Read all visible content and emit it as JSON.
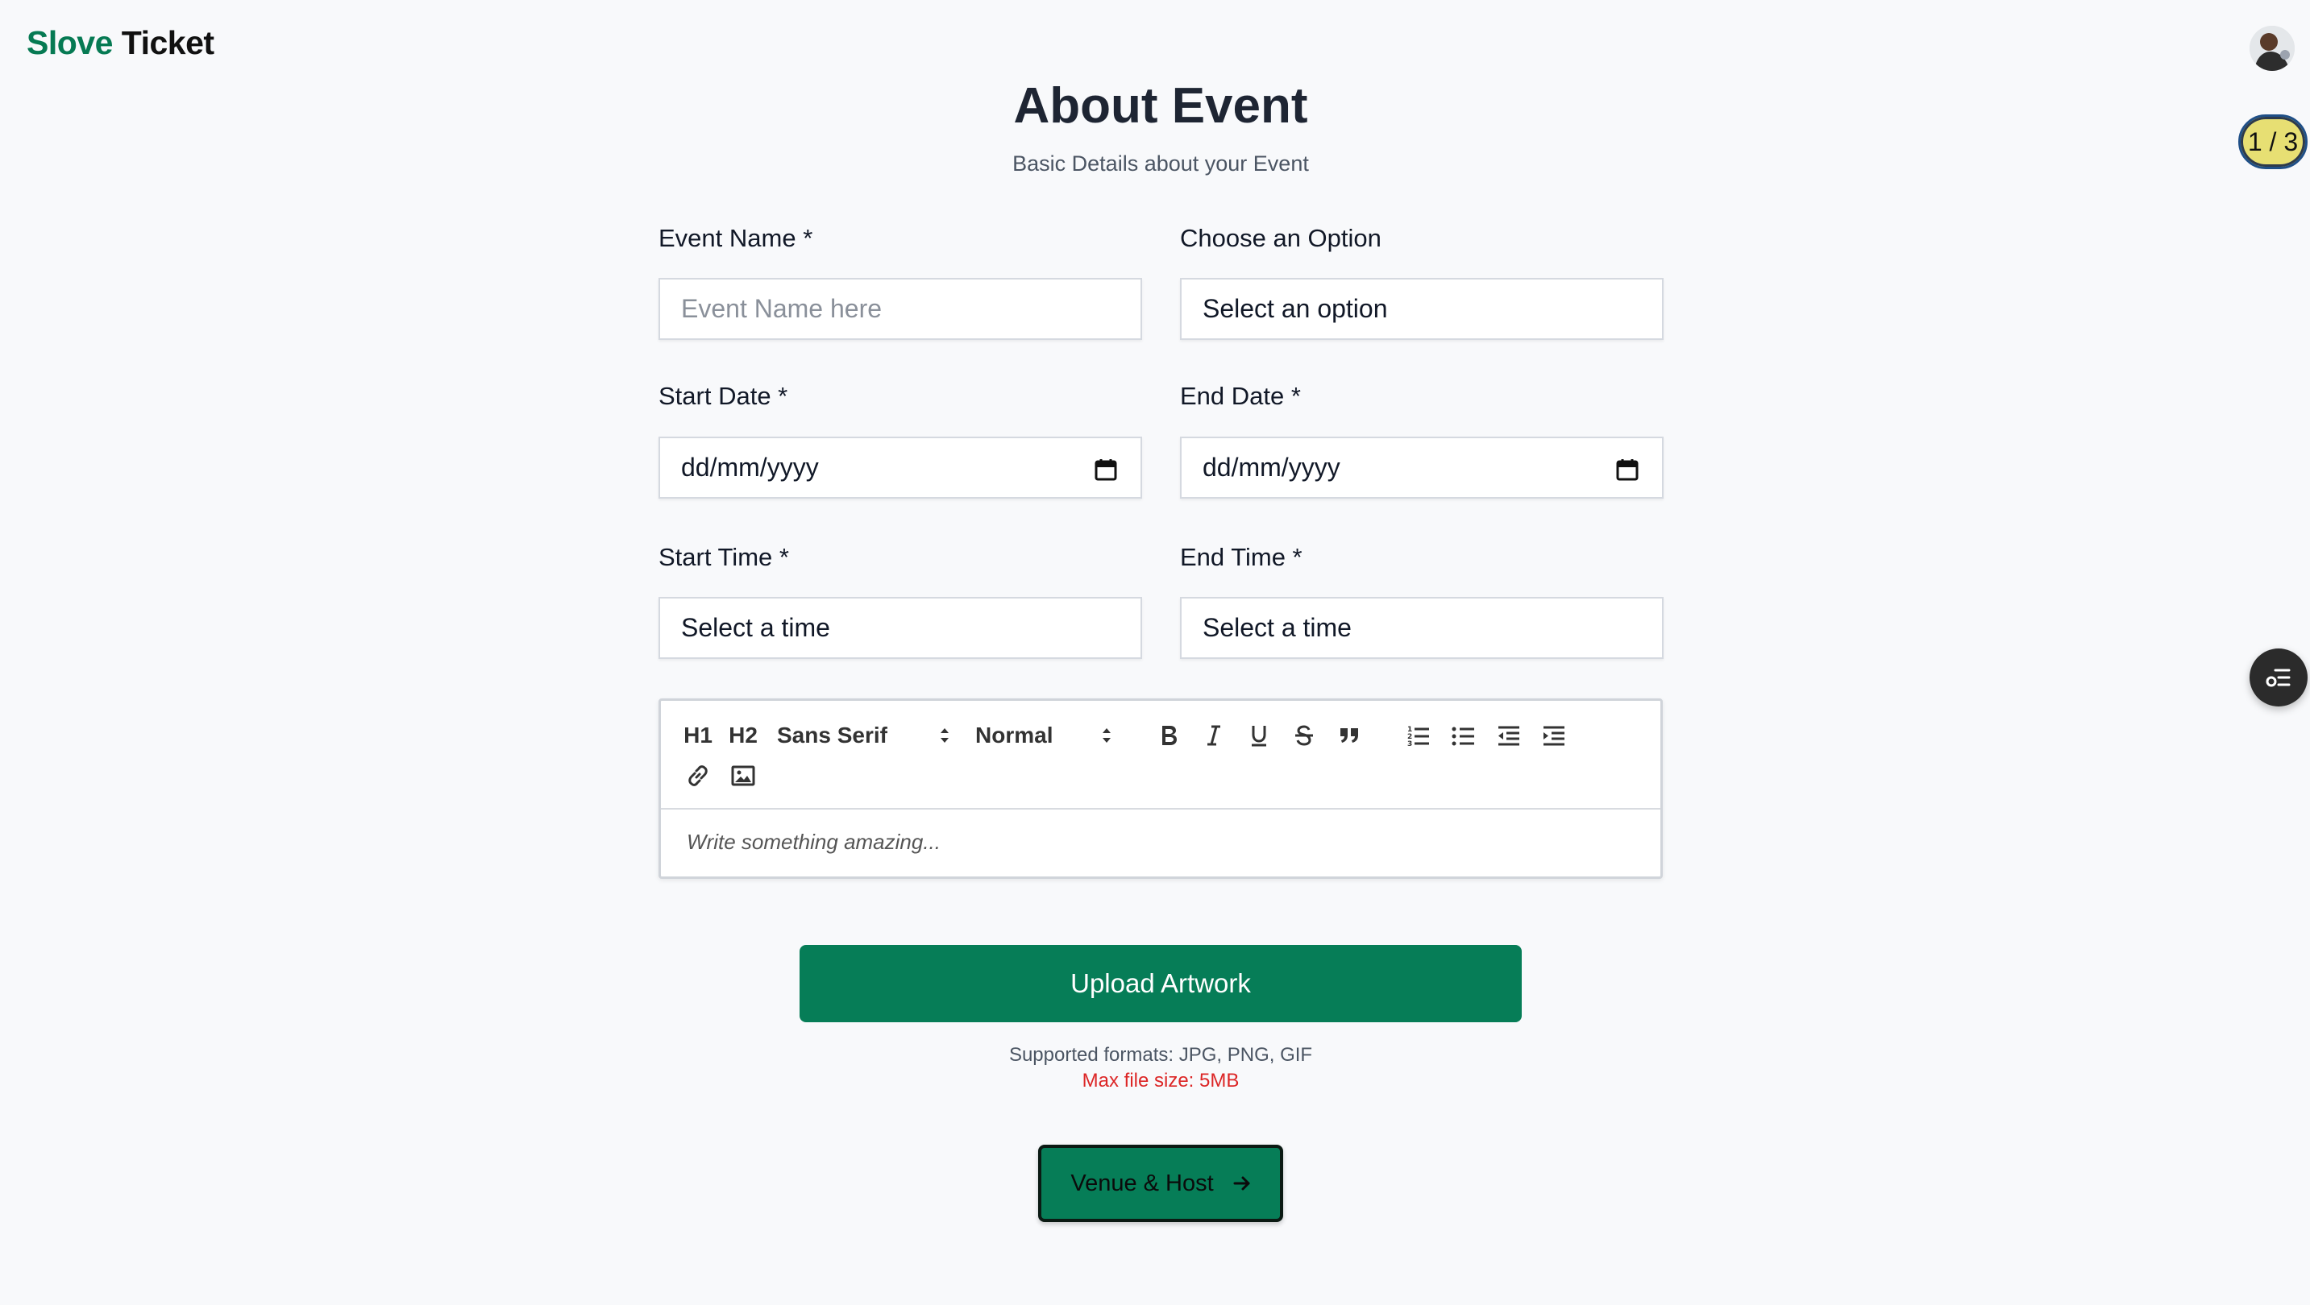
{
  "brand": {
    "part1": "Slove",
    "part2": "Ticket"
  },
  "step_indicator": "1 / 3",
  "page": {
    "title": "About Event",
    "subtitle": "Basic Details about your Event"
  },
  "form": {
    "event_name": {
      "label": "Event Name *",
      "placeholder": "Event Name here"
    },
    "option": {
      "label": "Choose an Option",
      "value": "Select an option"
    },
    "start_date": {
      "label": "Start Date *",
      "value": "dd/mm/yyyy"
    },
    "end_date": {
      "label": "End Date *",
      "value": "dd/mm/yyyy"
    },
    "start_time": {
      "label": "Start Time *",
      "value": "Select a time"
    },
    "end_time": {
      "label": "End Time *",
      "value": "Select a time"
    }
  },
  "editor": {
    "h1": "H1",
    "h2": "H2",
    "font": "Sans Serif",
    "size": "Normal",
    "placeholder": "Write something amazing..."
  },
  "upload": {
    "button": "Upload Artwork",
    "formats": "Supported formats: JPG, PNG, GIF",
    "max_size": "Max file size: 5MB"
  },
  "next_button": "Venue & Host",
  "colors": {
    "brand_green": "#067a53",
    "button_green": "#067d57",
    "error_red": "#dc2626",
    "badge_yellow": "#e7df73"
  }
}
